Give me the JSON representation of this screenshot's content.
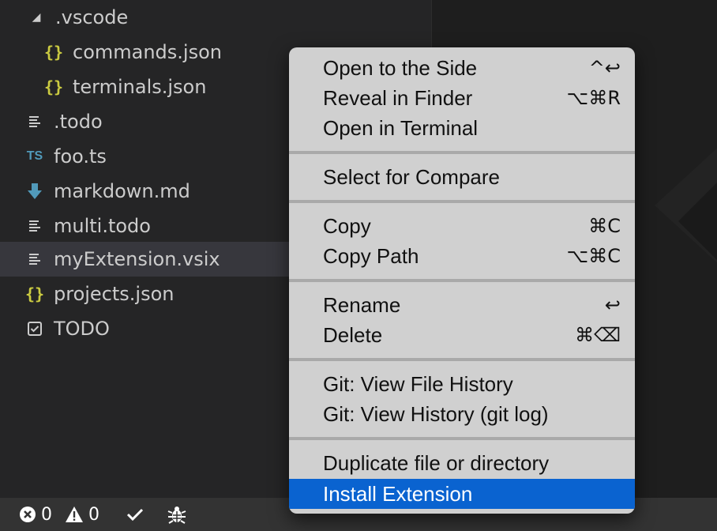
{
  "explorer": {
    "rows": [
      {
        "label": ".vscode",
        "icon": "expanded-triangle-icon"
      },
      {
        "label": "commands.json",
        "icon": "json-braces-icon"
      },
      {
        "label": "terminals.json",
        "icon": "json-braces-icon"
      },
      {
        "label": ".todo",
        "icon": "lines-file-icon"
      },
      {
        "label": "foo.ts",
        "icon": "typescript-icon",
        "icon_text": "TS"
      },
      {
        "label": "markdown.md",
        "icon": "markdown-icon"
      },
      {
        "label": "multi.todo",
        "icon": "lines-file-icon"
      },
      {
        "label": "myExtension.vsix",
        "icon": "lines-file-icon"
      },
      {
        "label": "projects.json",
        "icon": "json-braces-icon"
      },
      {
        "label": "TODO",
        "icon": "checkbox-icon"
      }
    ],
    "braces_glyph": "{}",
    "selected_label": "myExtension.vsix"
  },
  "context_menu": {
    "groups": [
      [
        {
          "label": "Open to the Side",
          "shortcut": "^↩"
        },
        {
          "label": "Reveal in Finder",
          "shortcut": "⌥⌘R"
        },
        {
          "label": "Open in Terminal",
          "shortcut": ""
        }
      ],
      [
        {
          "label": "Select for Compare",
          "shortcut": ""
        }
      ],
      [
        {
          "label": "Copy",
          "shortcut": "⌘C"
        },
        {
          "label": "Copy Path",
          "shortcut": "⌥⌘C"
        }
      ],
      [
        {
          "label": "Rename",
          "shortcut": "↩"
        },
        {
          "label": "Delete",
          "shortcut": "⌘⌫"
        }
      ],
      [
        {
          "label": "Git: View File History",
          "shortcut": ""
        },
        {
          "label": "Git: View History (git log)",
          "shortcut": ""
        }
      ],
      [
        {
          "label": "Duplicate file or directory",
          "shortcut": ""
        },
        {
          "label": "Install Extension",
          "shortcut": "",
          "highlighted": true
        }
      ]
    ]
  },
  "statusbar": {
    "errors_count": "0",
    "warnings_count": "0"
  },
  "colors": {
    "highlight": "#0a63d0",
    "json_icon": "#cbcb41",
    "ts_icon": "#519aba"
  }
}
